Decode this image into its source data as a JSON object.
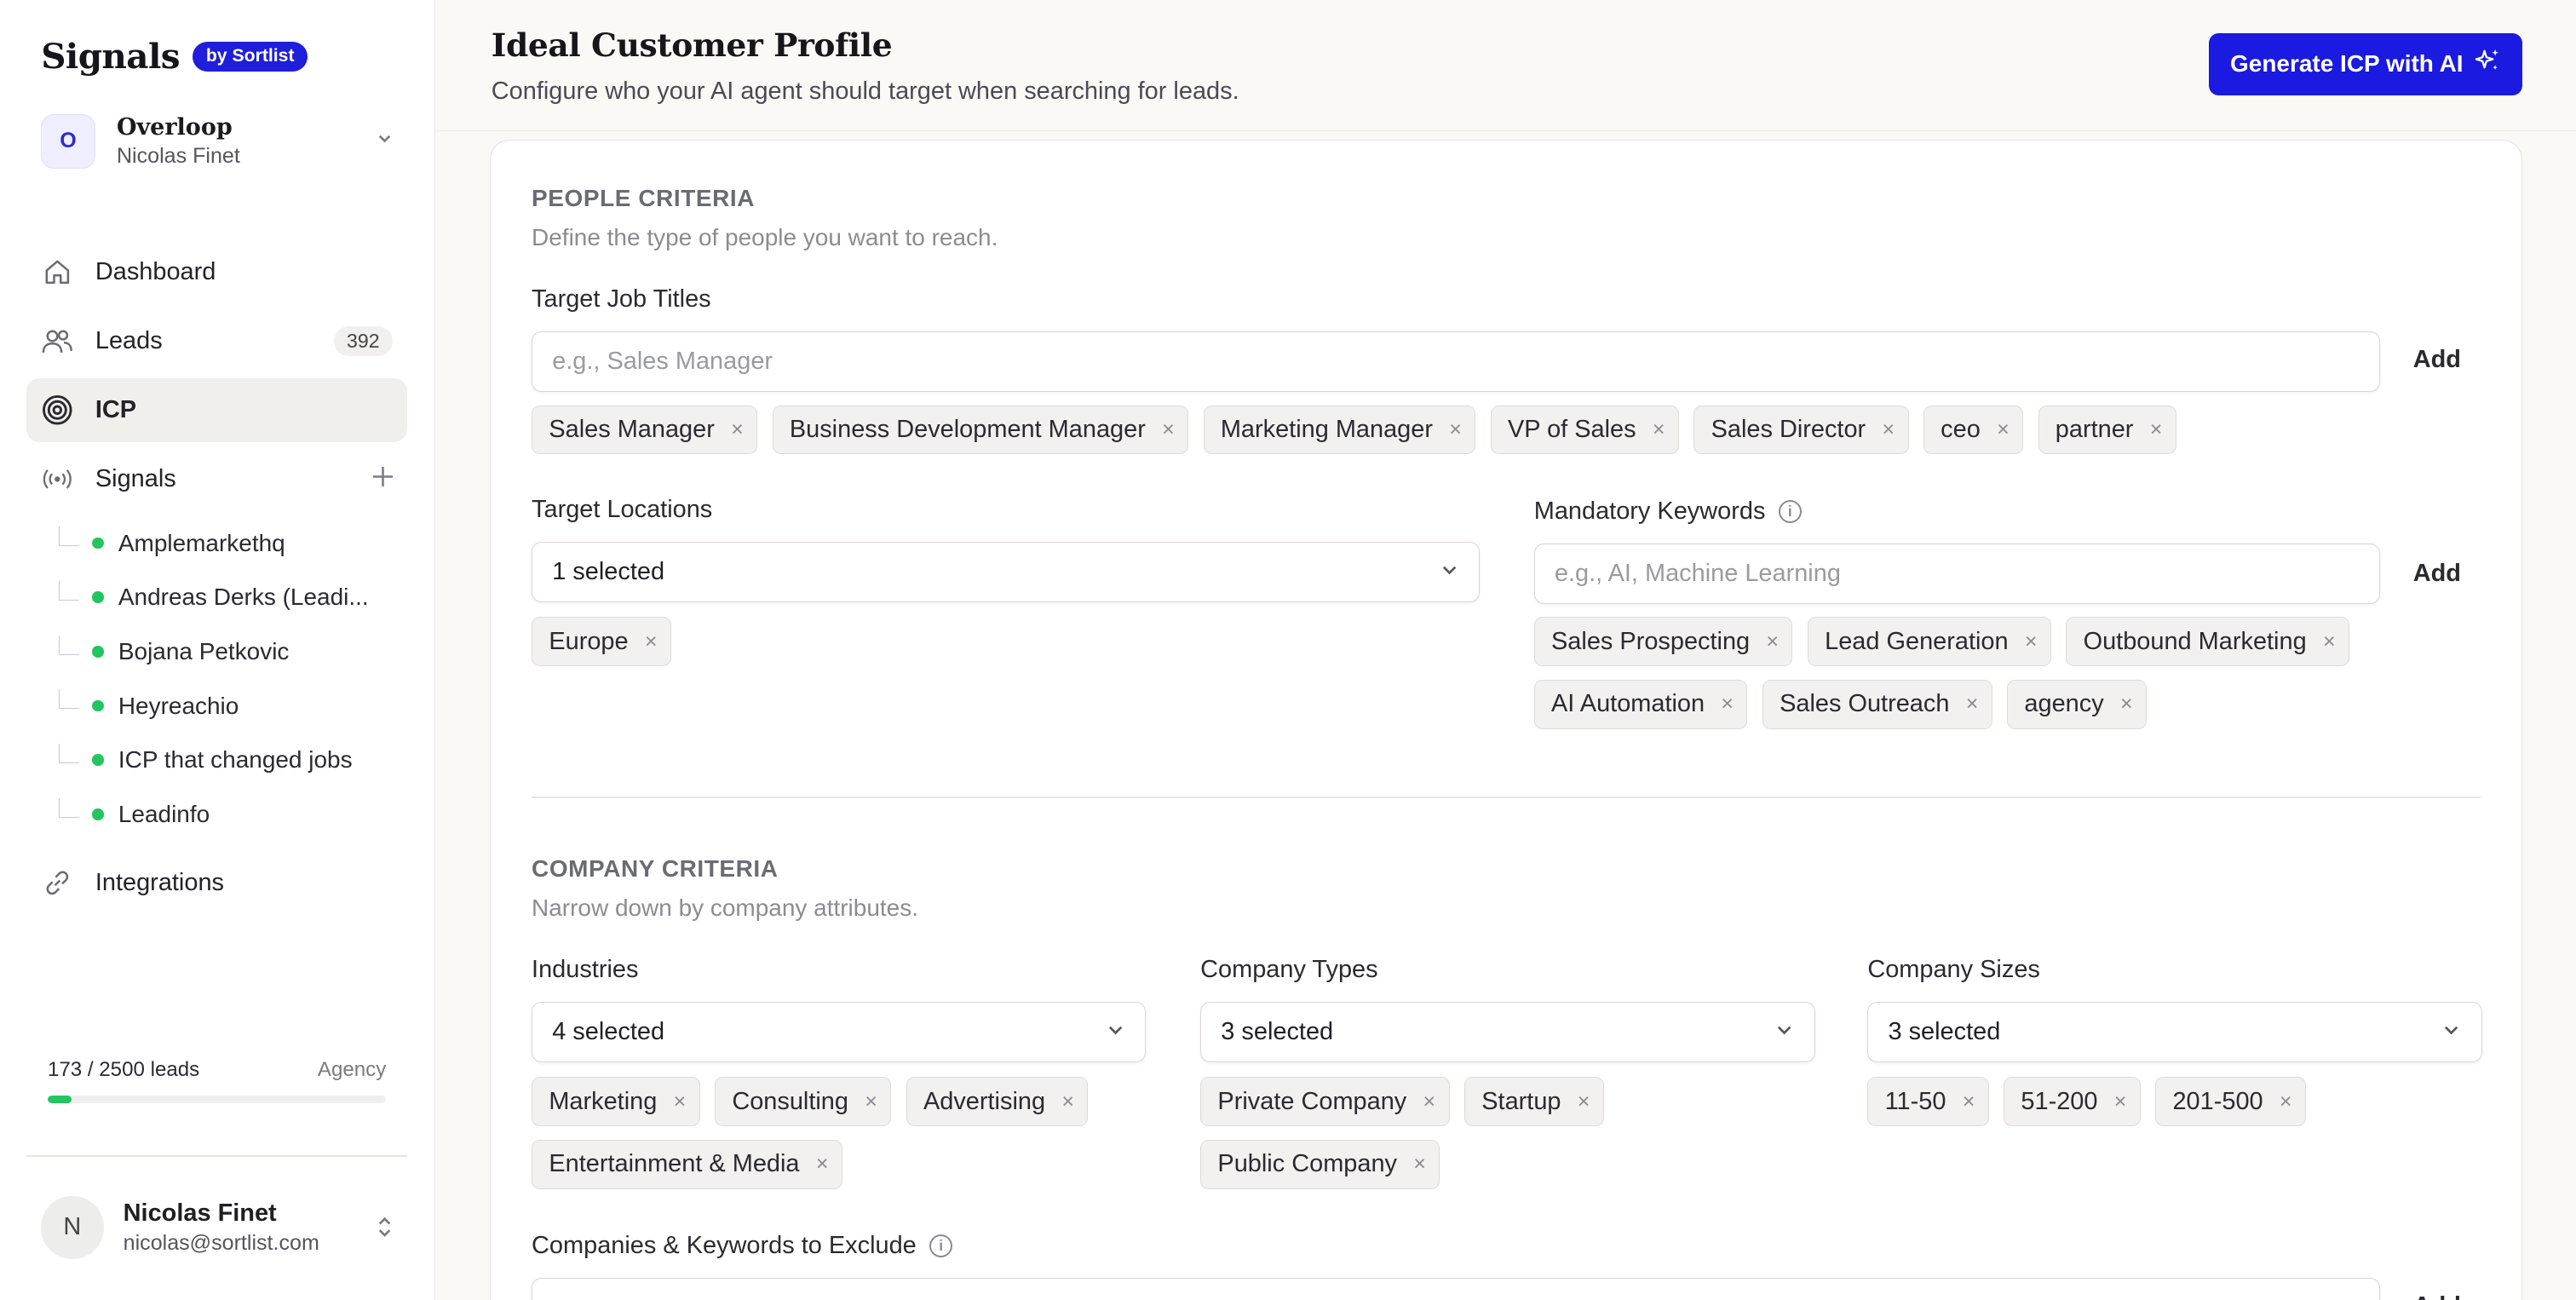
{
  "sidebar": {
    "brand": "Signals",
    "brand_badge": "by Sortlist",
    "workspace": {
      "initial": "O",
      "name": "Overloop",
      "user": "Nicolas Finet"
    },
    "nav": [
      {
        "label": "Dashboard",
        "icon": "home-icon"
      },
      {
        "label": "Leads",
        "icon": "users-icon",
        "count": "392"
      },
      {
        "label": "ICP",
        "icon": "target-icon",
        "active": true
      },
      {
        "label": "Signals",
        "icon": "broadcast-icon"
      }
    ],
    "signals": [
      {
        "label": "Amplemarkethq",
        "status_color": "#22c55e"
      },
      {
        "label": "Andreas Derks (Leadi...",
        "status_color": "#22c55e"
      },
      {
        "label": "Bojana Petkovic",
        "status_color": "#22c55e"
      },
      {
        "label": "Heyreachio",
        "status_color": "#22c55e"
      },
      {
        "label": "ICP that changed jobs",
        "status_color": "#22c55e"
      },
      {
        "label": "Leadinfo",
        "status_color": "#22c55e"
      }
    ],
    "integrations_label": "Integrations",
    "usage": {
      "text": "173 / 2500 leads",
      "plan": "Agency",
      "used": 173,
      "limit": 2500
    },
    "account": {
      "initial": "N",
      "name": "Nicolas Finet",
      "email": "nicolas@sortlist.com"
    }
  },
  "header": {
    "title": "Ideal Customer Profile",
    "subtitle": "Configure who your AI agent should target when searching for leads.",
    "generate_button": "Generate ICP with AI",
    "accent_color": "#1a1ae0"
  },
  "people": {
    "title": "PEOPLE CRITERIA",
    "description": "Define the type of people you want to reach.",
    "job_titles": {
      "label": "Target Job Titles",
      "placeholder": "e.g., Sales Manager",
      "add_label": "Add",
      "tags": [
        "Sales Manager",
        "Business Development Manager",
        "Marketing Manager",
        "VP of Sales",
        "Sales Director",
        "ceo",
        "partner"
      ]
    },
    "locations": {
      "label": "Target Locations",
      "selected": "1 selected",
      "tags": [
        "Europe"
      ]
    },
    "keywords": {
      "label": "Mandatory Keywords",
      "placeholder": "e.g., AI, Machine Learning",
      "add_label": "Add",
      "tags": [
        "Sales Prospecting",
        "Lead Generation",
        "Outbound Marketing",
        "AI Automation",
        "Sales Outreach",
        "agency"
      ]
    }
  },
  "company": {
    "title": "COMPANY CRITERIA",
    "description": "Narrow down by company attributes.",
    "industries": {
      "label": "Industries",
      "selected": "4 selected",
      "tags": [
        "Marketing",
        "Consulting",
        "Advertising",
        "Entertainment & Media"
      ]
    },
    "types": {
      "label": "Company Types",
      "selected": "3 selected",
      "tags": [
        "Private Company",
        "Startup",
        "Public Company"
      ]
    },
    "sizes": {
      "label": "Company Sizes",
      "selected": "3 selected",
      "tags": [
        "11-50",
        "51-200",
        "201-500"
      ]
    },
    "exclude": {
      "label": "Companies & Keywords to Exclude",
      "add_label": "Add"
    }
  }
}
